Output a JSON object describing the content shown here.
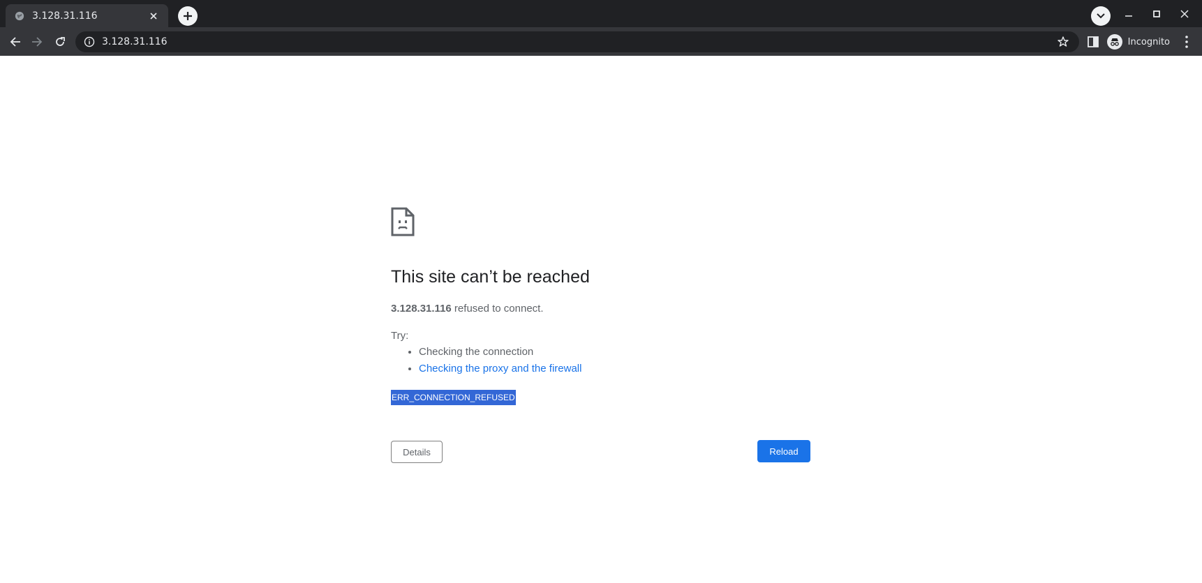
{
  "tab": {
    "title": "3.128.31.116"
  },
  "toolbar": {
    "url": "3.128.31.116",
    "profile_label": "Incognito"
  },
  "error": {
    "title": "This site can’t be reached",
    "host": "3.128.31.116",
    "message_suffix": " refused to connect.",
    "try_label": "Try:",
    "suggestions": [
      "Checking the connection",
      "Checking the proxy and the firewall"
    ],
    "code": "ERR_CONNECTION_REFUSED",
    "details_label": "Details",
    "reload_label": "Reload"
  },
  "colors": {
    "accent": "#1a73e8",
    "selection": "#3367d6",
    "chrome_dark": "#202124",
    "toolbar": "#35363a"
  }
}
